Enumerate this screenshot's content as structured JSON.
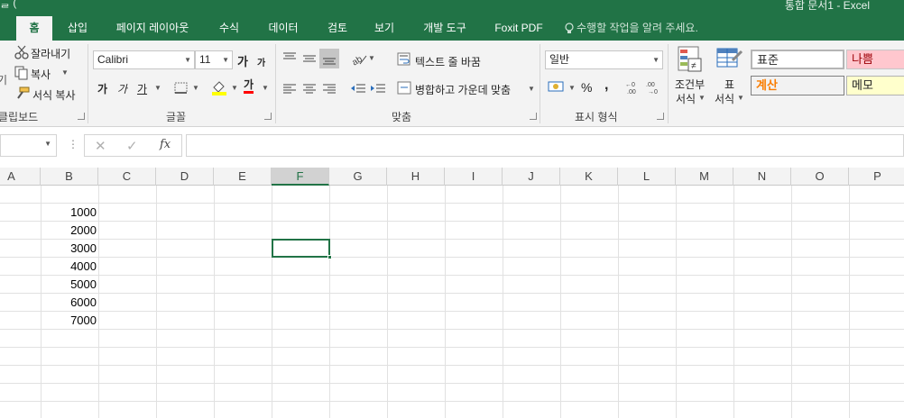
{
  "window": {
    "title": "통합 문서1 - Excel",
    "qat": "ᆯ  ("
  },
  "colors": {
    "accent": "#217346",
    "bad_bg": "#ffc7ce",
    "bad_fg": "#9c0006",
    "calc_fg": "#fa7d00",
    "note_bg": "#ffffcc"
  },
  "tabs": [
    "홈",
    "삽입",
    "페이지 레이아웃",
    "수식",
    "데이터",
    "검토",
    "보기",
    "개발 도구",
    "Foxit PDF"
  ],
  "tell_me": "수행할 작업을 알려 주세요.",
  "clipboard": {
    "cut": "잘라내기",
    "copy": "복사",
    "format_painter": "서식 복사",
    "group": "클립보드",
    "paste_partial": "기"
  },
  "font": {
    "name": "Calibri",
    "size": "11",
    "grow": "가",
    "shrink": "가",
    "bold": "가",
    "italic": "가",
    "underline": "가",
    "color_letter": "가",
    "group": "글꼴"
  },
  "alignment": {
    "wrap": "텍스트 줄 바꿈",
    "merge": "병합하고 가운데 맞춤",
    "group": "맞춤"
  },
  "number": {
    "format": "일반",
    "percent": "%",
    "comma": ",",
    "group": "표시 형식"
  },
  "styles": {
    "conditional_line1": "조건부",
    "conditional_line2": "서식",
    "table_line1": "표",
    "table_line2": "서식",
    "normal": "표준",
    "bad": "나쁨",
    "calc": "계산",
    "note": "메모"
  },
  "formula_bar": {
    "fx": "fx",
    "value": ""
  },
  "columns": [
    "A",
    "B",
    "C",
    "D",
    "E",
    "F",
    "G",
    "H",
    "I",
    "J",
    "K",
    "L",
    "M",
    "N",
    "O",
    "P"
  ],
  "selected_column": "F",
  "cells": {
    "B": [
      "1000",
      "2000",
      "3000",
      "4000",
      "5000",
      "6000",
      "7000"
    ]
  }
}
